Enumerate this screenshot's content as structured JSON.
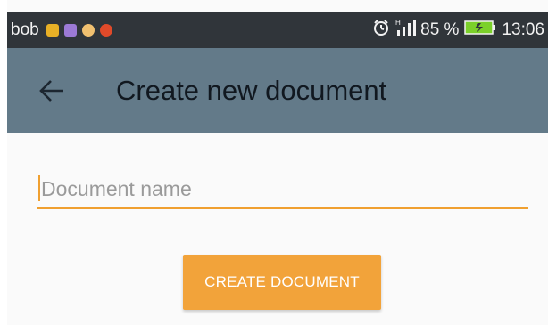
{
  "status_bar": {
    "user": "bob",
    "notification_icons": [
      {
        "name": "notification-app-icon-1",
        "color": "#e8b026"
      },
      {
        "name": "notification-app-icon-2",
        "color": "#9c7ad6"
      },
      {
        "name": "notification-app-icon-3",
        "color": "#f0c070"
      },
      {
        "name": "notification-app-icon-4",
        "color": "#e04a2a"
      }
    ],
    "battery_percent": "85 %",
    "time": "13:06",
    "icons": [
      "alarm-icon",
      "signal-icon",
      "battery-icon"
    ]
  },
  "toolbar": {
    "title": "Create new document",
    "back_icon": "arrow-left-icon"
  },
  "form": {
    "document_name": {
      "placeholder": "Document name",
      "value": ""
    },
    "create_button_label": "CREATE DOCUMENT"
  },
  "colors": {
    "status_bar_bg": "#30353a",
    "toolbar_bg": "#637a89",
    "accent": "#f2a33a",
    "content_bg": "#fafafa"
  }
}
